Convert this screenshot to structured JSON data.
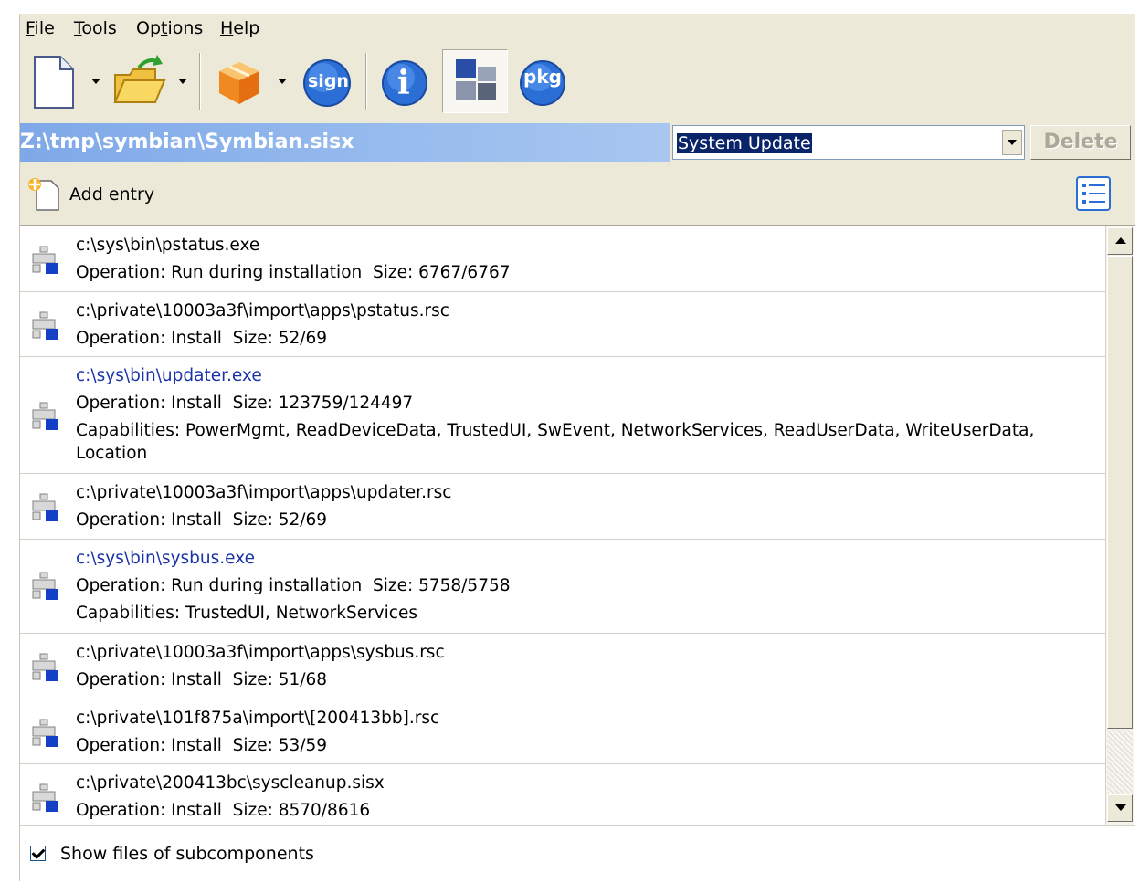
{
  "menu": [
    {
      "label": "File",
      "accel": "F",
      "rest": "ile"
    },
    {
      "label": "Tools",
      "accel": "T",
      "rest": "ools"
    },
    {
      "label": "Options",
      "pre": "Op",
      "accel": "t",
      "rest": "ions"
    },
    {
      "label": "Help",
      "accel": "H",
      "rest": "elp"
    }
  ],
  "toolbar": {
    "sign_label": "sign",
    "info_label": "i",
    "pkg_label": "pkg",
    "icons": [
      "new-file-icon",
      "open-folder-icon",
      "package-box-icon",
      "sign-icon",
      "info-icon",
      "components-view-icon",
      "pkg-icon"
    ]
  },
  "path": {
    "title": "Z:\\tmp\\symbian\\Symbian.sisx",
    "combo_value": "System Update",
    "delete_label": "Delete"
  },
  "entrybar": {
    "add_label": "Add entry"
  },
  "rows": [
    {
      "path": "c:\\sys\\bin\\pstatus.exe",
      "op": "Operation: Run during installation",
      "size": "Size: 6767/6767",
      "link": false
    },
    {
      "path": "c:\\private\\10003a3f\\import\\apps\\pstatus.rsc",
      "op": "Operation: Install",
      "size": "Size: 52/69",
      "link": false
    },
    {
      "path": "c:\\sys\\bin\\updater.exe",
      "op": "Operation: Install",
      "size": "Size: 123759/124497",
      "caps": "Capabilities: PowerMgmt, ReadDeviceData, TrustedUI, SwEvent, NetworkServices, ReadUserData, WriteUserData,",
      "caps2": "Location",
      "link": true
    },
    {
      "path": "c:\\private\\10003a3f\\import\\apps\\updater.rsc",
      "op": "Operation: Install",
      "size": "Size: 52/69",
      "link": false
    },
    {
      "path": "c:\\sys\\bin\\sysbus.exe",
      "op": "Operation: Run during installation",
      "size": "Size: 5758/5758",
      "caps": "Capabilities: TrustedUI, NetworkServices",
      "link": true
    },
    {
      "path": "c:\\private\\10003a3f\\import\\apps\\sysbus.rsc",
      "op": "Operation: Install",
      "size": "Size: 51/68",
      "link": false
    },
    {
      "path": "c:\\private\\101f875a\\import\\[200413bb].rsc",
      "op": "Operation: Install",
      "size": "Size: 53/59",
      "link": false
    },
    {
      "path": "c:\\private\\200413bc\\syscleanup.sisx",
      "op": "Operation: Install",
      "size": "Size: 8570/8616",
      "link": false
    }
  ],
  "bottom": {
    "checkbox_label": "Show files of subcomponents",
    "checked": true
  }
}
